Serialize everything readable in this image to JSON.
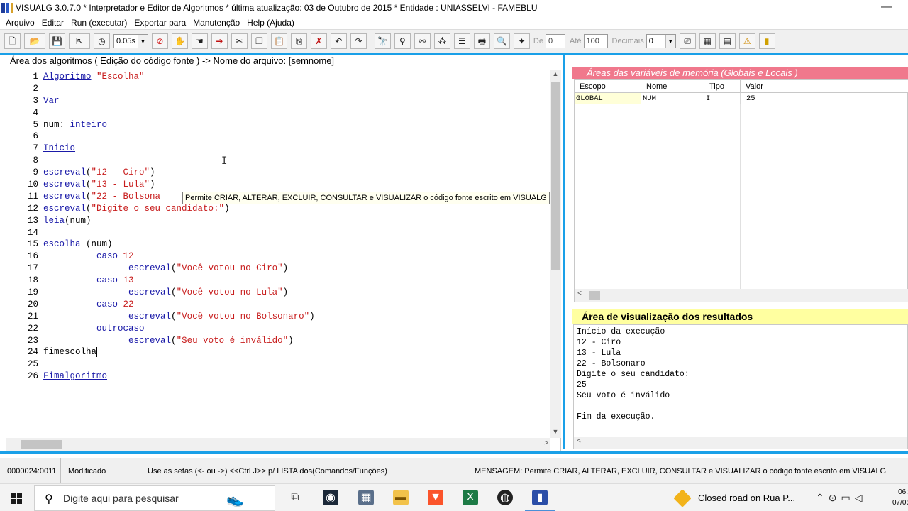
{
  "window": {
    "title": "VISUALG 3.0.7.0 * Interpretador e Editor de Algoritmos * última atualização: 03 de Outubro de 2015 * Entidade : UNIASSELVI - FAMEBLU",
    "minimize": "—"
  },
  "menu": [
    "Arquivo",
    "Editar",
    "Run (executar)",
    "Exportar para",
    "Manutenção",
    "Help (Ajuda)"
  ],
  "toolbar": {
    "speed_value": "0.05s",
    "de_label": "De",
    "de_value": "0",
    "ate_label": "Até",
    "ate_value": "100",
    "decimais_label": "Decimais",
    "decimais_value": "0"
  },
  "editor": {
    "header": "Área dos algoritmos ( Edição do código fonte ) -> Nome do arquivo: [semnome]",
    "lines": [
      {
        "n": "1",
        "parts": [
          [
            "kw",
            "Algoritmo"
          ],
          [
            "plain",
            " "
          ],
          [
            "str",
            "\"Escolha\""
          ]
        ]
      },
      {
        "n": "2",
        "parts": []
      },
      {
        "n": "3",
        "parts": [
          [
            "kw",
            "Var"
          ]
        ]
      },
      {
        "n": "4",
        "parts": []
      },
      {
        "n": "5",
        "parts": [
          [
            "plain",
            "num: "
          ],
          [
            "kw",
            "inteiro"
          ]
        ]
      },
      {
        "n": "6",
        "parts": []
      },
      {
        "n": "7",
        "parts": [
          [
            "kw",
            "Inicio"
          ]
        ]
      },
      {
        "n": "8",
        "parts": []
      },
      {
        "n": "9",
        "parts": [
          [
            "kw2",
            "escreval"
          ],
          [
            "plain",
            "("
          ],
          [
            "str",
            "\"12 - Ciro\""
          ],
          [
            "plain",
            ")"
          ]
        ]
      },
      {
        "n": "10",
        "parts": [
          [
            "kw2",
            "escreval"
          ],
          [
            "plain",
            "("
          ],
          [
            "str",
            "\"13 - Lula\""
          ],
          [
            "plain",
            ")"
          ]
        ]
      },
      {
        "n": "11",
        "parts": [
          [
            "kw2",
            "escreval"
          ],
          [
            "plain",
            "("
          ],
          [
            "str",
            "\"22 - Bolsona"
          ]
        ]
      },
      {
        "n": "12",
        "parts": [
          [
            "kw2",
            "escreval"
          ],
          [
            "plain",
            "("
          ],
          [
            "str",
            "\"Digite o seu candidato:\""
          ],
          [
            "plain",
            ")"
          ]
        ]
      },
      {
        "n": "13",
        "parts": [
          [
            "kw2",
            "leia"
          ],
          [
            "plain",
            "(num)"
          ]
        ]
      },
      {
        "n": "14",
        "parts": []
      },
      {
        "n": "15",
        "parts": [
          [
            "kw2",
            "escolha"
          ],
          [
            "plain",
            " (num)"
          ]
        ]
      },
      {
        "n": "16",
        "parts": [
          [
            "plain",
            "          "
          ],
          [
            "kw2",
            "caso"
          ],
          [
            "plain",
            " "
          ],
          [
            "num",
            "12"
          ]
        ]
      },
      {
        "n": "17",
        "parts": [
          [
            "plain",
            "                "
          ],
          [
            "kw2",
            "escreval"
          ],
          [
            "plain",
            "("
          ],
          [
            "str",
            "\"Você votou no Ciro\""
          ],
          [
            "plain",
            ")"
          ]
        ]
      },
      {
        "n": "18",
        "parts": [
          [
            "plain",
            "          "
          ],
          [
            "kw2",
            "caso"
          ],
          [
            "plain",
            " "
          ],
          [
            "num",
            "13"
          ]
        ]
      },
      {
        "n": "19",
        "parts": [
          [
            "plain",
            "                "
          ],
          [
            "kw2",
            "escreval"
          ],
          [
            "plain",
            "("
          ],
          [
            "str",
            "\"Você votou no Lula\""
          ],
          [
            "plain",
            ")"
          ]
        ]
      },
      {
        "n": "20",
        "parts": [
          [
            "plain",
            "          "
          ],
          [
            "kw2",
            "caso"
          ],
          [
            "plain",
            " "
          ],
          [
            "num",
            "22"
          ]
        ]
      },
      {
        "n": "21",
        "parts": [
          [
            "plain",
            "                "
          ],
          [
            "kw2",
            "escreval"
          ],
          [
            "plain",
            "("
          ],
          [
            "str",
            "\"Você votou no Bolsonaro\""
          ],
          [
            "plain",
            ")"
          ]
        ]
      },
      {
        "n": "22",
        "parts": [
          [
            "plain",
            "          "
          ],
          [
            "kw2",
            "outrocaso"
          ]
        ]
      },
      {
        "n": "23",
        "parts": [
          [
            "plain",
            "                "
          ],
          [
            "kw2",
            "escreval"
          ],
          [
            "plain",
            "("
          ],
          [
            "str",
            "\"Seu voto é inválido\""
          ],
          [
            "plain",
            ")"
          ]
        ]
      },
      {
        "n": "24",
        "parts": [
          [
            "plain",
            "fimescolha"
          ]
        ],
        "caret": true
      },
      {
        "n": "25",
        "parts": []
      },
      {
        "n": "26",
        "parts": [
          [
            "kw",
            "Fimalgoritmo"
          ]
        ]
      }
    ],
    "tooltip": "Permite CRIAR, ALTERAR, EXCLUIR, CONSULTAR e VISUALIZAR o código fonte escrito em VISUALG"
  },
  "variables": {
    "header": "Áreas das variáveis de memória (Globais e Locais )",
    "columns": [
      "Escopo",
      "Nome",
      "Tipo",
      "Valor"
    ],
    "rows": [
      [
        "GLOBAL",
        "NUM",
        "I",
        "25"
      ]
    ]
  },
  "output": {
    "header": "Área de visualização dos resultados",
    "lines": [
      "Início da execução",
      "12 - Ciro",
      "13 - Lula",
      "22 - Bolsonaro",
      "Digite o seu candidato:",
      "25",
      "Seu voto é inválido",
      "",
      "Fim da execução."
    ]
  },
  "status": {
    "position": "0000024:0011",
    "state": "Modificado",
    "hint": "Use as setas (<- ou ->) <<Ctrl J>> p/ LISTA dos(Comandos/Funções)",
    "message": "MENSAGEM: Permite CRIAR, ALTERAR, EXCLUIR, CONSULTAR e VISUALIZAR o código fonte escrito em VISUALG"
  },
  "taskbar": {
    "search_placeholder": "Digite aqui para pesquisar",
    "notification": "Closed road on Rua P...",
    "time": "06:",
    "date": "07/06"
  },
  "colors": {
    "accent_blue": "#1aa0e8",
    "vars_header": "#f0788c",
    "output_header": "#ffffa0",
    "keyword": "#1a1aa8",
    "string": "#c81e1e"
  }
}
